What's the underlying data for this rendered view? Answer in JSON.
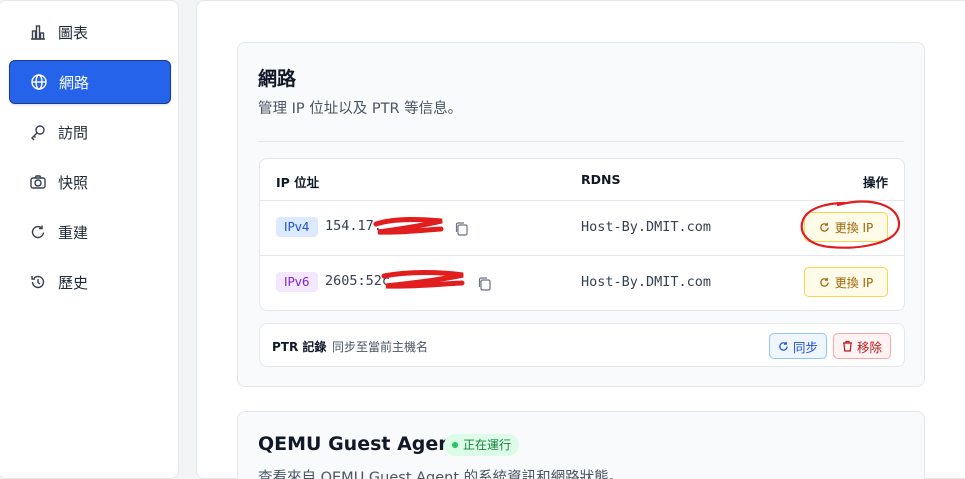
{
  "sidebar": {
    "items": [
      {
        "label": "圖表",
        "icon": "bar-chart-icon"
      },
      {
        "label": "網路",
        "icon": "globe-icon",
        "active": true
      },
      {
        "label": "訪問",
        "icon": "key-icon"
      },
      {
        "label": "快照",
        "icon": "camera-icon"
      },
      {
        "label": "重建",
        "icon": "rotate-icon"
      },
      {
        "label": "歷史",
        "icon": "history-icon"
      }
    ]
  },
  "network": {
    "title": "網路",
    "description": "管理 IP 位址以及 PTR 等信息。",
    "table": {
      "headers": {
        "ip": "IP 位址",
        "rdns": "RDNS",
        "action": "操作"
      },
      "rows": [
        {
          "type": "IPv4",
          "ip": "154.17.",
          "rdns": "Host-By.DMIT.com",
          "action": "更換 IP"
        },
        {
          "type": "IPv6",
          "ip": "2605:52c",
          "rdns": "Host-By.DMIT.com",
          "action": "更換 IP"
        }
      ]
    },
    "ptr": {
      "label": "PTR 記錄",
      "hint": "同步至當前主機名",
      "sync": "同步",
      "remove": "移除"
    }
  },
  "agent": {
    "title": "QEMU Guest Agent",
    "status": "正在運行",
    "description": "查看來自 QEMU Guest Agent 的系統資訊和網路狀態。"
  },
  "colors": {
    "accent": "#2563eb",
    "annotation": "#e11d1d"
  }
}
